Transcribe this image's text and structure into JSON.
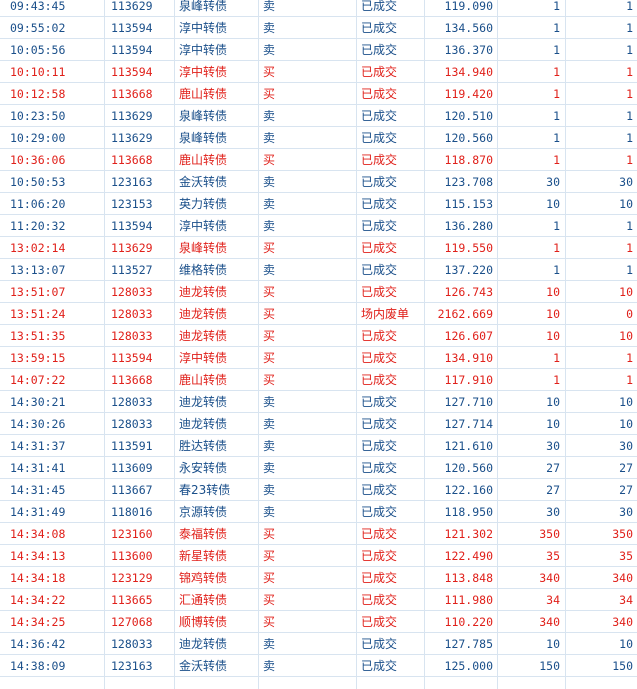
{
  "colors": {
    "sell": "#1a4f8a",
    "buy": "#e0201a",
    "grid_line": "#d8e4f0"
  },
  "rows": [
    {
      "time": "09:43:45",
      "code": "113629",
      "name": "泉峰转债",
      "dir": "卖",
      "status": "已成交",
      "price": "119.090",
      "qty": "1",
      "filled": "1",
      "side": "sell"
    },
    {
      "time": "09:55:02",
      "code": "113594",
      "name": "淳中转债",
      "dir": "卖",
      "status": "已成交",
      "price": "134.560",
      "qty": "1",
      "filled": "1",
      "side": "sell"
    },
    {
      "time": "10:05:56",
      "code": "113594",
      "name": "淳中转债",
      "dir": "卖",
      "status": "已成交",
      "price": "136.370",
      "qty": "1",
      "filled": "1",
      "side": "sell"
    },
    {
      "time": "10:10:11",
      "code": "113594",
      "name": "淳中转债",
      "dir": "买",
      "status": "已成交",
      "price": "134.940",
      "qty": "1",
      "filled": "1",
      "side": "buy"
    },
    {
      "time": "10:12:58",
      "code": "113668",
      "name": "鹿山转债",
      "dir": "买",
      "status": "已成交",
      "price": "119.420",
      "qty": "1",
      "filled": "1",
      "side": "buy"
    },
    {
      "time": "10:23:50",
      "code": "113629",
      "name": "泉峰转债",
      "dir": "卖",
      "status": "已成交",
      "price": "120.510",
      "qty": "1",
      "filled": "1",
      "side": "sell"
    },
    {
      "time": "10:29:00",
      "code": "113629",
      "name": "泉峰转债",
      "dir": "卖",
      "status": "已成交",
      "price": "120.560",
      "qty": "1",
      "filled": "1",
      "side": "sell"
    },
    {
      "time": "10:36:06",
      "code": "113668",
      "name": "鹿山转债",
      "dir": "买",
      "status": "已成交",
      "price": "118.870",
      "qty": "1",
      "filled": "1",
      "side": "buy"
    },
    {
      "time": "10:50:53",
      "code": "123163",
      "name": "金沃转债",
      "dir": "卖",
      "status": "已成交",
      "price": "123.708",
      "qty": "30",
      "filled": "30",
      "side": "sell"
    },
    {
      "time": "11:06:20",
      "code": "123153",
      "name": "英力转债",
      "dir": "卖",
      "status": "已成交",
      "price": "115.153",
      "qty": "10",
      "filled": "10",
      "side": "sell"
    },
    {
      "time": "11:20:32",
      "code": "113594",
      "name": "淳中转债",
      "dir": "卖",
      "status": "已成交",
      "price": "136.280",
      "qty": "1",
      "filled": "1",
      "side": "sell"
    },
    {
      "time": "13:02:14",
      "code": "113629",
      "name": "泉峰转债",
      "dir": "买",
      "status": "已成交",
      "price": "119.550",
      "qty": "1",
      "filled": "1",
      "side": "buy"
    },
    {
      "time": "13:13:07",
      "code": "113527",
      "name": "维格转债",
      "dir": "卖",
      "status": "已成交",
      "price": "137.220",
      "qty": "1",
      "filled": "1",
      "side": "sell"
    },
    {
      "time": "13:51:07",
      "code": "128033",
      "name": "迪龙转债",
      "dir": "买",
      "status": "已成交",
      "price": "126.743",
      "qty": "10",
      "filled": "10",
      "side": "buy"
    },
    {
      "time": "13:51:24",
      "code": "128033",
      "name": "迪龙转债",
      "dir": "买",
      "status": "场内废单",
      "price": "2162.669",
      "qty": "10",
      "filled": "0",
      "side": "buy"
    },
    {
      "time": "13:51:35",
      "code": "128033",
      "name": "迪龙转债",
      "dir": "买",
      "status": "已成交",
      "price": "126.607",
      "qty": "10",
      "filled": "10",
      "side": "buy"
    },
    {
      "time": "13:59:15",
      "code": "113594",
      "name": "淳中转债",
      "dir": "买",
      "status": "已成交",
      "price": "134.910",
      "qty": "1",
      "filled": "1",
      "side": "buy"
    },
    {
      "time": "14:07:22",
      "code": "113668",
      "name": "鹿山转债",
      "dir": "买",
      "status": "已成交",
      "price": "117.910",
      "qty": "1",
      "filled": "1",
      "side": "buy"
    },
    {
      "time": "14:30:21",
      "code": "128033",
      "name": "迪龙转债",
      "dir": "卖",
      "status": "已成交",
      "price": "127.710",
      "qty": "10",
      "filled": "10",
      "side": "sell"
    },
    {
      "time": "14:30:26",
      "code": "128033",
      "name": "迪龙转债",
      "dir": "卖",
      "status": "已成交",
      "price": "127.714",
      "qty": "10",
      "filled": "10",
      "side": "sell"
    },
    {
      "time": "14:31:37",
      "code": "113591",
      "name": "胜达转债",
      "dir": "卖",
      "status": "已成交",
      "price": "121.610",
      "qty": "30",
      "filled": "30",
      "side": "sell"
    },
    {
      "time": "14:31:41",
      "code": "113609",
      "name": "永安转债",
      "dir": "卖",
      "status": "已成交",
      "price": "120.560",
      "qty": "27",
      "filled": "27",
      "side": "sell"
    },
    {
      "time": "14:31:45",
      "code": "113667",
      "name": "春23转债",
      "dir": "卖",
      "status": "已成交",
      "price": "122.160",
      "qty": "27",
      "filled": "27",
      "side": "sell"
    },
    {
      "time": "14:31:49",
      "code": "118016",
      "name": "京源转债",
      "dir": "卖",
      "status": "已成交",
      "price": "118.950",
      "qty": "30",
      "filled": "30",
      "side": "sell"
    },
    {
      "time": "14:34:08",
      "code": "123160",
      "name": "泰福转债",
      "dir": "买",
      "status": "已成交",
      "price": "121.302",
      "qty": "350",
      "filled": "350",
      "side": "buy"
    },
    {
      "time": "14:34:13",
      "code": "113600",
      "name": "新星转债",
      "dir": "买",
      "status": "已成交",
      "price": "122.490",
      "qty": "35",
      "filled": "35",
      "side": "buy"
    },
    {
      "time": "14:34:18",
      "code": "123129",
      "name": "锦鸡转债",
      "dir": "买",
      "status": "已成交",
      "price": "113.848",
      "qty": "340",
      "filled": "340",
      "side": "buy"
    },
    {
      "time": "14:34:22",
      "code": "113665",
      "name": "汇通转债",
      "dir": "买",
      "status": "已成交",
      "price": "111.980",
      "qty": "34",
      "filled": "34",
      "side": "buy"
    },
    {
      "time": "14:34:25",
      "code": "127068",
      "name": "顺博转债",
      "dir": "买",
      "status": "已成交",
      "price": "110.220",
      "qty": "340",
      "filled": "340",
      "side": "buy"
    },
    {
      "time": "14:36:42",
      "code": "128033",
      "name": "迪龙转债",
      "dir": "卖",
      "status": "已成交",
      "price": "127.785",
      "qty": "10",
      "filled": "10",
      "side": "sell"
    },
    {
      "time": "14:38:09",
      "code": "123163",
      "name": "金沃转债",
      "dir": "卖",
      "status": "已成交",
      "price": "125.000",
      "qty": "150",
      "filled": "150",
      "side": "sell"
    }
  ]
}
